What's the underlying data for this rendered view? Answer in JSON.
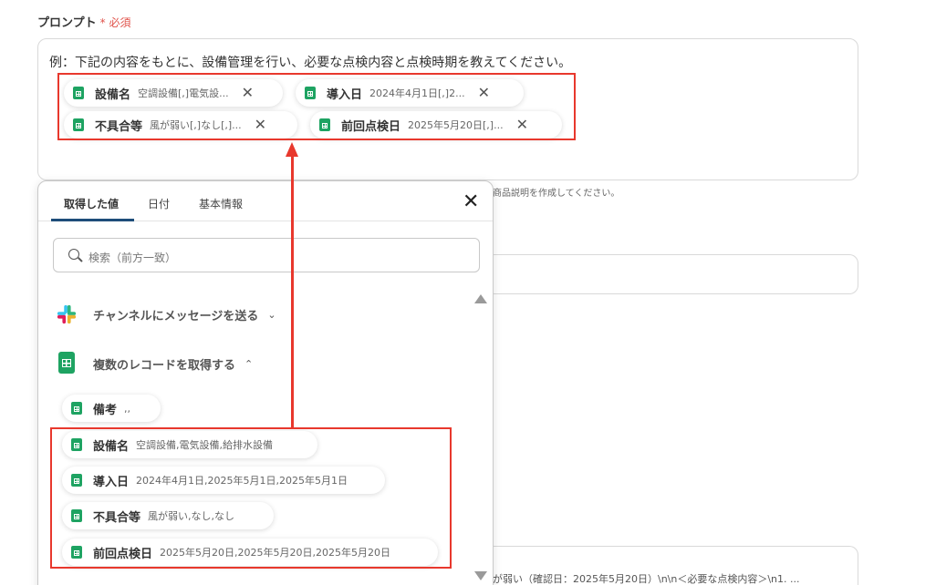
{
  "label": {
    "title": "プロンプト",
    "required": "* 必須"
  },
  "prompt": {
    "text": "例：下記の内容をもとに、設備管理を行い、必要な点検内容と点検時期を教えてください。",
    "chips": [
      {
        "name": "設備名",
        "value": "空調設備[,]電気設..."
      },
      {
        "name": "導入日",
        "value": "2024年4月1日[,]2..."
      },
      {
        "name": "不具合等",
        "value": "風が弱い[,]なし[,]..."
      },
      {
        "name": "前回点検日",
        "value": "2025年5月20日[,]..."
      }
    ]
  },
  "hint": "商品説明を作成してください。",
  "field3_text": "が弱い（確認日：2025年5月20日）\\n\\n＜必要な点検内容＞\\n1. ...",
  "panel": {
    "tabs": [
      "取得した値",
      "日付",
      "基本情報"
    ],
    "search_placeholder": "検索（前方一致）",
    "groups": [
      {
        "label": "チャンネルにメッセージを送る",
        "icon": "slack-icon",
        "chevron": "⌄"
      },
      {
        "label": "複数のレコードを取得する",
        "icon": "sheets-icon",
        "chevron": "⌃"
      }
    ],
    "items": [
      {
        "name": "備考",
        "value": ",,"
      },
      {
        "name": "設備名",
        "value": "空調設備,電気設備,給排水設備"
      },
      {
        "name": "導入日",
        "value": "2024年4月1日,2025年5月1日,2025年5月1日"
      },
      {
        "name": "不具合等",
        "value": "風が弱い,なし,なし"
      },
      {
        "name": "前回点検日",
        "value": "2025年5月20日,2025年5月20日,2025年5月20日"
      }
    ]
  },
  "colors": {
    "accent_red": "#e8382d",
    "sheets_green": "#1ea362",
    "tab_underline": "#1e4d7a"
  }
}
